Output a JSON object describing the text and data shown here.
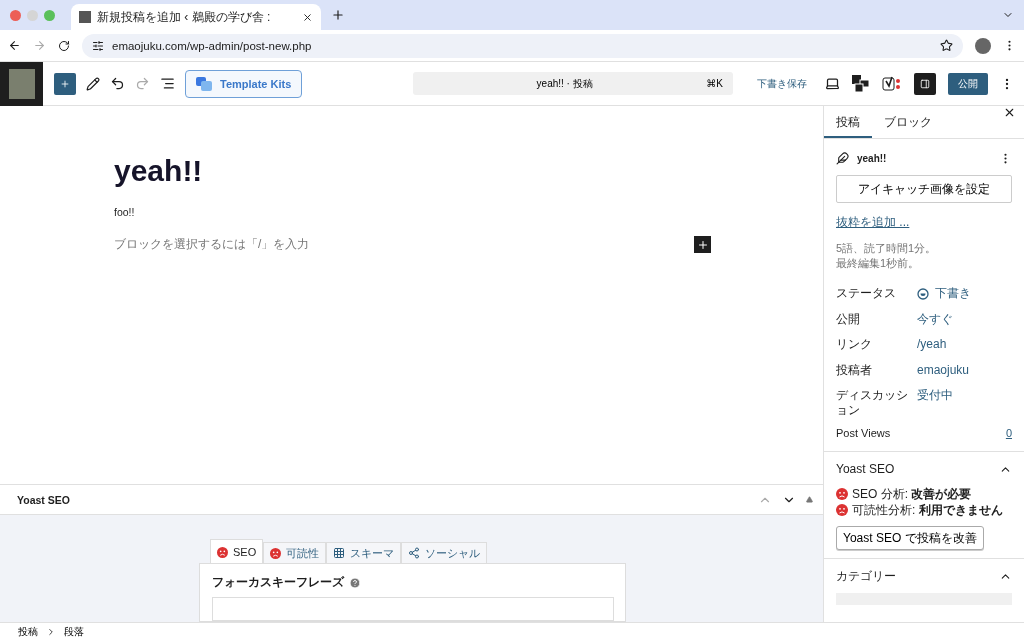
{
  "browser": {
    "tab_title": "新規投稿を追加 ‹ 鵜殿の学び舎 :",
    "url": "emaojuku.com/wp-admin/post-new.php"
  },
  "toolbar": {
    "template_kits": "Template Kits",
    "command_title": "yeah!! · 投稿",
    "shortcut": "⌘K",
    "save_draft": "下書き保存",
    "publish": "公開"
  },
  "editor": {
    "title": "yeah!!",
    "paragraph": "foo!!",
    "placeholder": "ブロックを選択するには「/」を入力"
  },
  "sidebar": {
    "tabs": [
      {
        "label": "投稿",
        "selected": true
      },
      {
        "label": "ブロック",
        "selected": false
      }
    ],
    "post_title": "yeah!!",
    "featured_button": "アイキャッチ画像を設定",
    "excerpt_link": "抜粋を追加 ...",
    "stats": [
      "5語、読了時間1分。",
      "最終編集1秒前。"
    ],
    "fields": [
      {
        "label": "ステータス",
        "value": "下書き",
        "kind": "status"
      },
      {
        "label": "公開",
        "value": "今すぐ",
        "kind": "link"
      },
      {
        "label": "リンク",
        "value": "/yeah",
        "kind": "link"
      },
      {
        "label": "投稿者",
        "value": "emaojuku",
        "kind": "link"
      },
      {
        "label": "ディスカッション",
        "value": "受付中",
        "kind": "link"
      }
    ],
    "post_views": {
      "label": "Post Views",
      "value": "0"
    },
    "yoast": {
      "title": "Yoast SEO",
      "items": [
        {
          "label": "SEO 分析:",
          "value": "改善が必要"
        },
        {
          "label": "可読性分析:",
          "value": "利用できません"
        }
      ],
      "button": "Yoast SEO で投稿を改善"
    },
    "category": {
      "title": "カテゴリー"
    }
  },
  "metabox": {
    "title": "Yoast SEO",
    "tabs": [
      {
        "label": "SEO",
        "kind": "score",
        "selected": true
      },
      {
        "label": "可読性",
        "kind": "score",
        "selected": false
      },
      {
        "label": "スキーマ",
        "kind": "grid",
        "selected": false
      },
      {
        "label": "ソーシャル",
        "kind": "share",
        "selected": false
      }
    ],
    "focus_label": "フォーカスキーフレーズ"
  },
  "breadcrumb": [
    "投稿",
    "段落"
  ]
}
